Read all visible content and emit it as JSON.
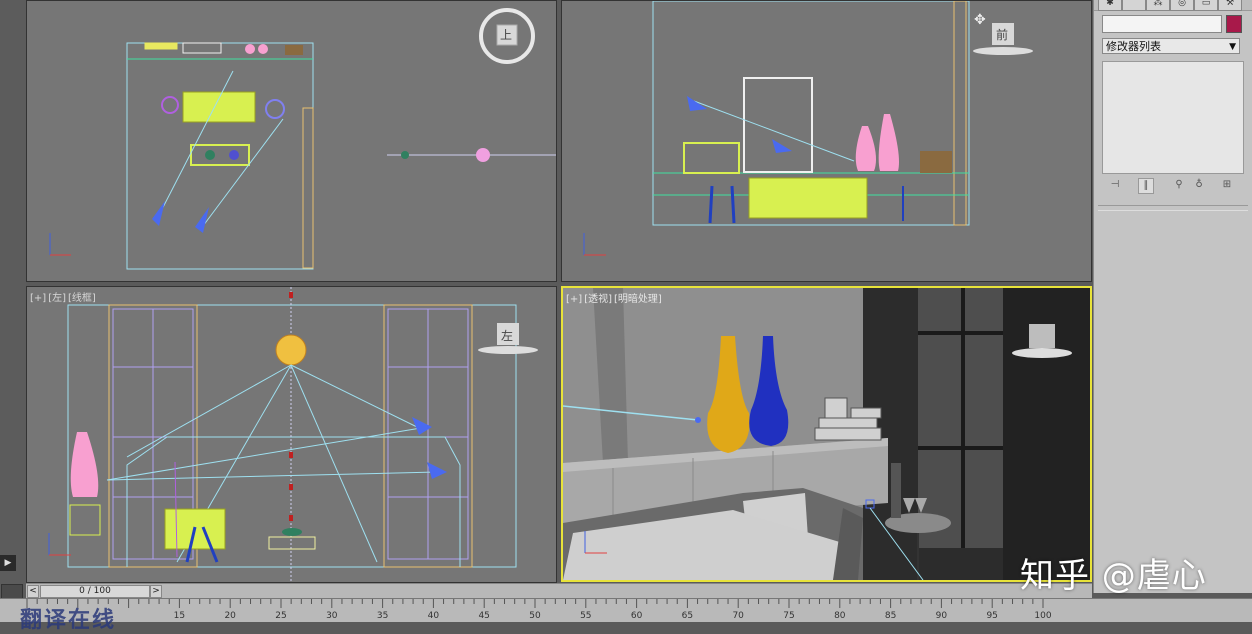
{
  "viewports": {
    "top": {
      "cube_label": "上"
    },
    "front": {
      "cube_label": "前"
    },
    "left": {
      "label_plus": "[+]",
      "label_view": "[左]",
      "label_shading": "[线框]",
      "cube_label": "左"
    },
    "perspective": {
      "label_plus": "[+]",
      "label_view": "[透视]",
      "label_shading": "[明暗处理]"
    }
  },
  "command_panel": {
    "tabs": [
      "create-icon",
      "modify-icon",
      "hierarchy-icon",
      "motion-icon",
      "display-icon",
      "utilities-icon"
    ],
    "modifier_list": "修改器列表",
    "object_color": "#a8194a"
  },
  "timeline": {
    "prev": "<",
    "frame_display": "0 / 100",
    "next": ">",
    "ticks": [
      "15",
      "20",
      "25",
      "30",
      "35",
      "40",
      "45",
      "50",
      "55",
      "60",
      "65",
      "70",
      "75",
      "80",
      "85",
      "90",
      "95",
      "100"
    ]
  },
  "watermark": {
    "text": "知乎 @虐心"
  },
  "colors": {
    "active_viewport_border": "#e8e33a",
    "viewport_bg": "#767676",
    "perspective_bg": "#3a3a3a"
  }
}
